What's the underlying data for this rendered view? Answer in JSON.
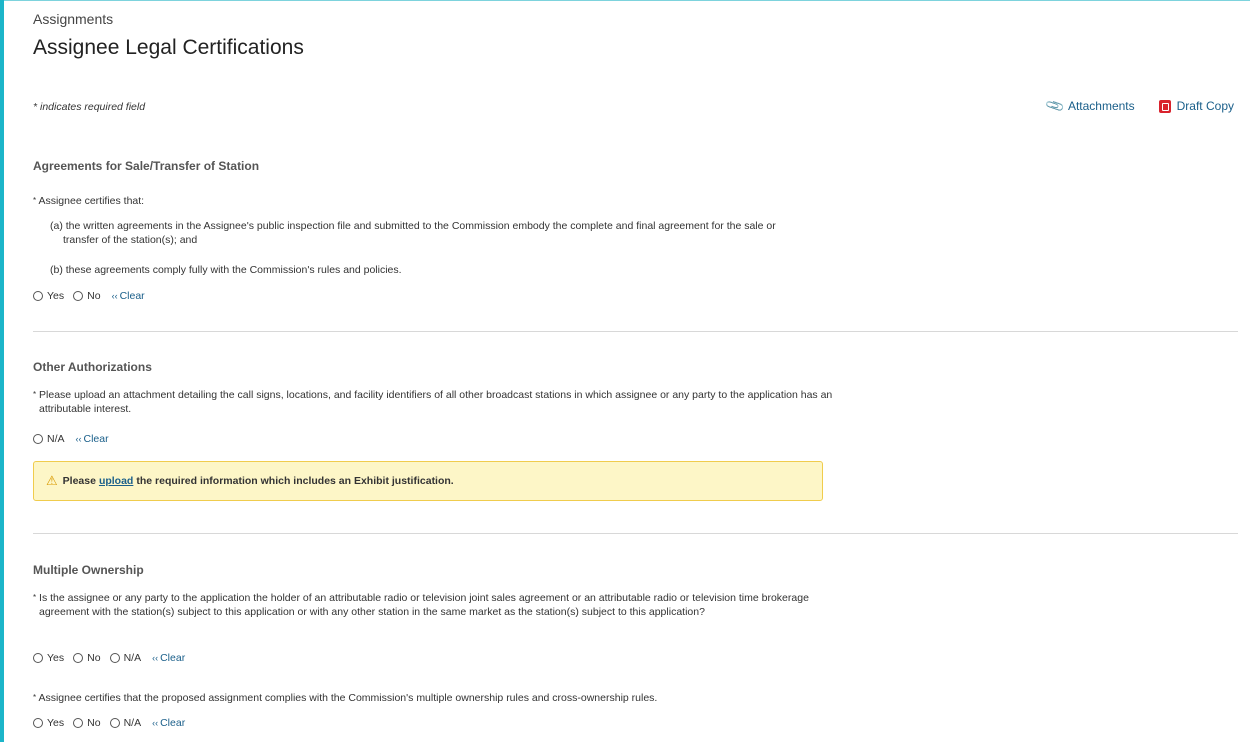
{
  "breadcrumb": "Assignments",
  "page_title": "Assignee Legal Certifications",
  "required_note": "* indicates required field",
  "toolbar": {
    "attachments_label": "Attachments",
    "draft_copy_label": "Draft Copy"
  },
  "sections": {
    "agreements": {
      "title": "Agreements for Sale/Transfer of Station",
      "question": "Assignee certifies that:",
      "item_a": "(a) the written agreements in the Assignee's public inspection file and submitted to the Commission embody the complete and final agreement for the sale or transfer of the station(s); and",
      "item_b": "(b) these agreements comply fully with the Commission's rules and policies.",
      "options": [
        "Yes",
        "No"
      ],
      "clear_label": "Clear"
    },
    "other_authorizations": {
      "title": "Other Authorizations",
      "question": "Please upload an attachment detailing the call signs, locations, and facility identifiers of all other broadcast stations in which assignee or any party to the application has an attributable interest.",
      "options": [
        "N/A"
      ],
      "clear_label": "Clear",
      "warning_before": "Please",
      "warning_link": "upload",
      "warning_after": "the required information which includes an Exhibit justification."
    },
    "multiple_ownership": {
      "title": "Multiple Ownership",
      "question1": "Is the assignee or any party to the application the holder of an attributable radio or television joint sales agreement or an attributable radio or television time brokerage agreement with the station(s) subject to this application or with any other station in the same market as the station(s) subject to this application?",
      "question1_options": [
        "Yes",
        "No",
        "N/A"
      ],
      "question2": "Assignee certifies that the proposed assignment complies with the Commission's multiple ownership rules and cross-ownership rules.",
      "question2_options": [
        "Yes",
        "No",
        "N/A"
      ],
      "clear_label": "Clear"
    }
  },
  "required_marker": "*",
  "colors": {
    "accent_bar": "#1cb5c9",
    "link": "#1a5f8a",
    "warning_bg": "#fdf6c7",
    "warning_border": "#f0cc4d",
    "pdf_icon": "#d9232d"
  }
}
